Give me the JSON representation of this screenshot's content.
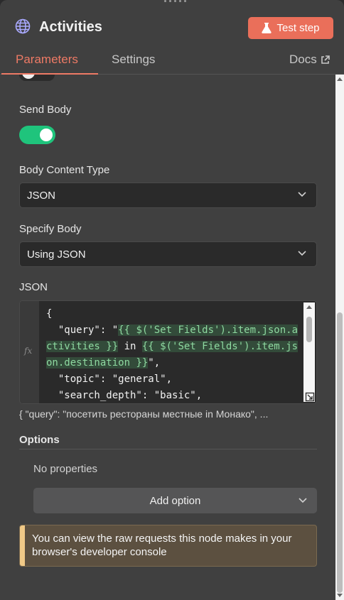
{
  "header": {
    "title": "Activities",
    "test_button_label": "Test step",
    "icon": "globe-icon",
    "accent_color": "#ea6f5a"
  },
  "tabs": [
    {
      "label": "Parameters",
      "active": true
    },
    {
      "label": "Settings",
      "active": false
    },
    {
      "label": "Docs",
      "active": false
    }
  ],
  "fields": {
    "send_body_label": "Send Body",
    "send_body_on": true,
    "body_content_type_label": "Body Content Type",
    "body_content_type_value": "JSON",
    "specify_body_label": "Specify Body",
    "specify_body_value": "Using JSON",
    "json_label": "JSON"
  },
  "json_editor": {
    "fx": "fx",
    "line1": "{",
    "line2_key": "  \"query\": \"",
    "line2_expr1": "{{ $('Set Fields').item.json.activities }}",
    "line2_mid": " in ",
    "line2_expr2": "{{ $('Set Fields').item.json.destination }}",
    "line2_end": "\",",
    "line3": "  \"topic\": \"general\",",
    "line4": "  \"search_depth\": \"basic\","
  },
  "preview": "{   \"query\": \"посетить рестораны местные in Монако\",  ...",
  "options": {
    "label": "Options",
    "empty_text": "No properties",
    "add_option_label": "Add option"
  },
  "notice": {
    "text": "You can view the raw requests this node makes in your browser's developer console",
    "accent_color": "#f0c987"
  }
}
